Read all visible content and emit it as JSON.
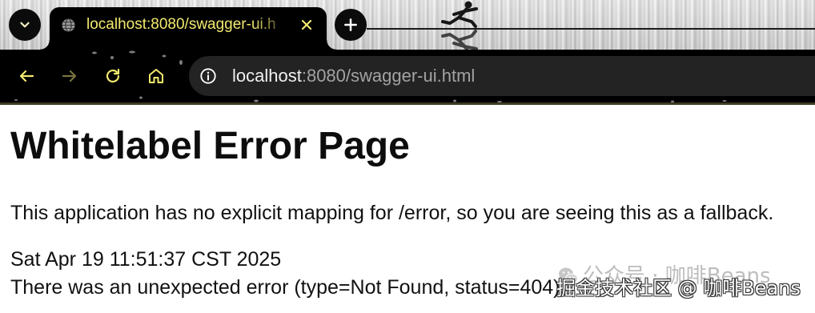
{
  "browser": {
    "tab_search": {
      "icon": "chevron-down-icon"
    },
    "active_tab": {
      "favicon": "globe-icon",
      "title": "localhost:8080/swagger-ui.h",
      "close_icon": "close-icon"
    },
    "new_tab": {
      "icon": "plus-icon"
    },
    "toolbar": {
      "back_icon": "arrow-left-icon",
      "forward_icon": "arrow-right-icon",
      "reload_icon": "reload-icon",
      "home_icon": "home-icon"
    },
    "omnibox": {
      "site_info_icon": "info-icon",
      "url_host": "localhost",
      "url_rest": ":8080/swagger-ui.html"
    },
    "colors": {
      "theme_accent": "#f3ea6e",
      "toolbar": "#000000",
      "omnibox": "#232323",
      "url_host": "#f1f1f1",
      "url_rest": "#a3a3a3"
    }
  },
  "page": {
    "heading": "Whitelabel Error Page",
    "message": "This application has no explicit mapping for /error, so you are seeing this as a fallback.",
    "timestamp": "Sat Apr 19 11:51:37 CST 2025",
    "error_detail": "There was an unexpected error (type=Not Found, status=404)."
  },
  "watermark": {
    "icon": "wechat-icon",
    "account_text": "公众号 · 咖啡Beans",
    "source_text": "掘金技术社区 @ 咖啡Beans"
  }
}
